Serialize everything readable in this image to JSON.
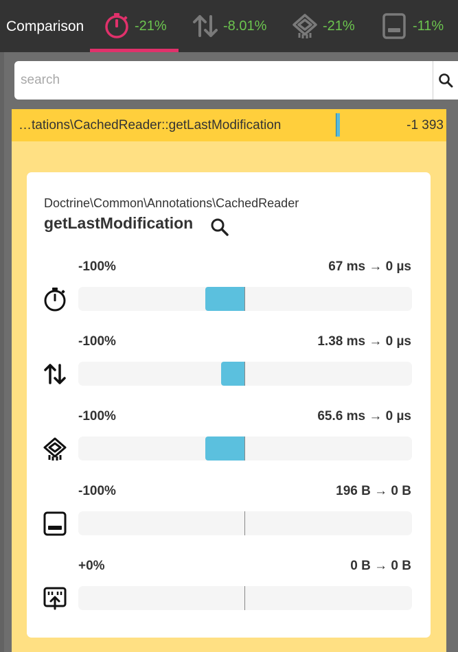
{
  "header": {
    "title": "Comparison",
    "tabs": [
      {
        "icon": "stopwatch-icon",
        "value": "-21%",
        "active": true
      },
      {
        "icon": "io-arrows-icon",
        "value": "-8.01%",
        "active": false
      },
      {
        "icon": "cpu-chip-icon",
        "value": "-21%",
        "active": false
      },
      {
        "icon": "memory-icon",
        "value": "-11%",
        "active": false
      }
    ]
  },
  "search": {
    "placeholder": "search",
    "value": ""
  },
  "result": {
    "name": "…tations\\CachedReader::getLastModification",
    "value": "-1 393"
  },
  "detail": {
    "namespace": "Doctrine\\Common\\Annotations\\CachedReader",
    "function": "getLastModification",
    "metrics": [
      {
        "icon": "stopwatch-icon",
        "percent": "-100%",
        "change": "67 ms → 0 µs",
        "fill": 0.05
      },
      {
        "icon": "io-arrows-icon",
        "percent": "-100%",
        "change": "1.38 ms → 0 µs",
        "fill": 0.03
      },
      {
        "icon": "cpu-chip-icon",
        "percent": "-100%",
        "change": "65.6 ms → 0 µs",
        "fill": 0.05
      },
      {
        "icon": "memory-icon",
        "percent": "-100%",
        "change": "196 B → 0 B",
        "fill": 0
      },
      {
        "icon": "network-icon",
        "percent": "+0%",
        "change": "0 B → 0 B",
        "fill": 0
      }
    ]
  },
  "colors": {
    "accent": "#e0316b",
    "positive": "#6cc54f",
    "bar": "#5bc0de",
    "highlight": "#ffcf3c",
    "panel": "#ffe083"
  }
}
